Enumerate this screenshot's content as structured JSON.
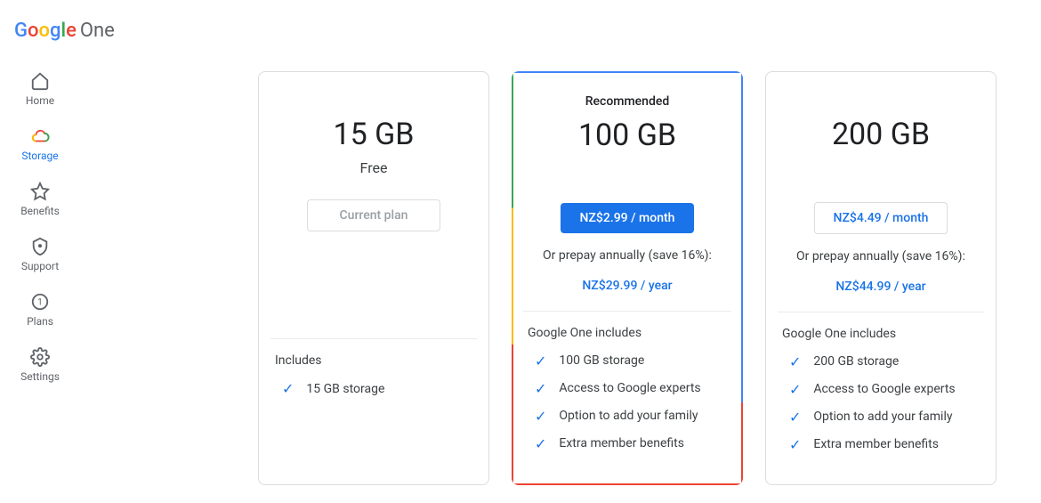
{
  "logo": {
    "product": "One"
  },
  "sidebar": {
    "items": [
      {
        "id": "home",
        "label": "Home"
      },
      {
        "id": "storage",
        "label": "Storage"
      },
      {
        "id": "benefits",
        "label": "Benefits"
      },
      {
        "id": "support",
        "label": "Support"
      },
      {
        "id": "plans",
        "label": "Plans"
      },
      {
        "id": "settings",
        "label": "Settings"
      }
    ]
  },
  "plans": [
    {
      "tag": "",
      "size": "15 GB",
      "sub": "Free",
      "button": "Current plan",
      "button_kind": "disabled",
      "prepay": "",
      "annual": "",
      "includes_title": "Includes",
      "features": [
        "15 GB storage"
      ]
    },
    {
      "tag": "Recommended",
      "size": "100 GB",
      "sub": "",
      "button": "NZ$2.99 / month",
      "button_kind": "primary",
      "prepay": "Or prepay annually (save 16%):",
      "annual": "NZ$29.99 / year",
      "includes_title": "Google One includes",
      "features": [
        "100 GB storage",
        "Access to Google experts",
        "Option to add your family",
        "Extra member benefits"
      ]
    },
    {
      "tag": "",
      "size": "200 GB",
      "sub": "",
      "button": "NZ$4.49 / month",
      "button_kind": "outline",
      "prepay": "Or prepay annually (save 16%):",
      "annual": "NZ$44.99 / year",
      "includes_title": "Google One includes",
      "features": [
        "200 GB storage",
        "Access to Google experts",
        "Option to add your family",
        "Extra member benefits"
      ]
    }
  ]
}
